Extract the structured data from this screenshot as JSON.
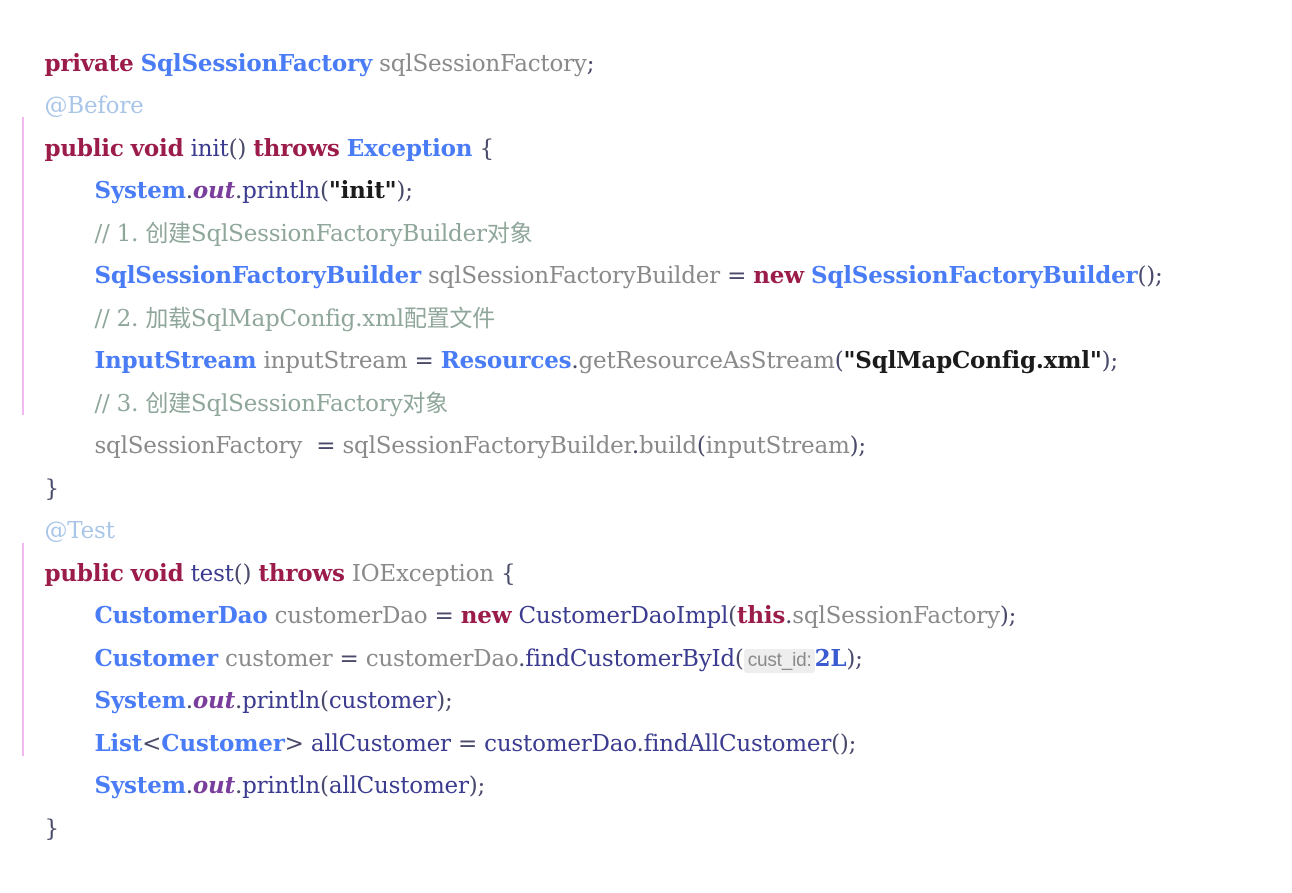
{
  "editor": {
    "language": "java",
    "background": "#ffffff",
    "indent_guide_color": "#f2b8f2",
    "colors": {
      "keyword": "#9b1c4b",
      "type": "#4a7cf6",
      "comment": "#8fa69a",
      "annotation": "#a9c6e8",
      "string": "#1b1b1b",
      "static_field": "#7a3f9d",
      "number": "#3b5bd0",
      "identifier": "#8a8a8a",
      "parameter_hint_bg": "#eeeeee"
    }
  },
  "code": {
    "line01": {
      "kw_private": "private",
      "type_sqlsessionfactory": "SqlSessionFactory",
      "field_name": "sqlSessionFactory",
      "semi": ";"
    },
    "line02": {
      "annotation": "@Before"
    },
    "line03": {
      "kw_public": "public",
      "kw_void": "void",
      "method": "init",
      "parens": "()",
      "kw_throws": "throws",
      "type_exception": "Exception",
      "brace": "{"
    },
    "line04": {
      "system": "System",
      "dot1": ".",
      "out": "out",
      "dot2": ".",
      "println": "println",
      "open": "(",
      "string": "\"init\"",
      "close": ")",
      "semi": ";"
    },
    "line05": {
      "comment": "// 1. 创建SqlSessionFactoryBuilder对象"
    },
    "line06": {
      "type_builder": "SqlSessionFactoryBuilder",
      "var": "sqlSessionFactoryBuilder",
      "eq": "=",
      "kw_new": "new",
      "ctor": "SqlSessionFactoryBuilder",
      "parens": "()",
      "semi": ";"
    },
    "line07": {
      "comment": "// 2. 加载SqlMapConfig.xml配置文件"
    },
    "line08": {
      "type_inputstream": "InputStream",
      "var": "inputStream",
      "eq": "=",
      "type_resources": "Resources",
      "dot": ".",
      "method": "getResourceAsStream",
      "open": "(",
      "string": "\"SqlMapConfig.xml\"",
      "close": ")",
      "semi": ";"
    },
    "line09": {
      "comment": "// 3. 创建SqlSessionFactory对象"
    },
    "line10": {
      "field": "sqlSessionFactory",
      "eq": "=",
      "var": "sqlSessionFactoryBuilder",
      "dot": ".",
      "method": "build",
      "open": "(",
      "arg": "inputStream",
      "close": ")",
      "semi": ";"
    },
    "line11": {
      "brace": "}"
    },
    "line12": {
      "annotation": "@Test"
    },
    "line13": {
      "kw_public": "public",
      "kw_void": "void",
      "method": "test",
      "parens": "()",
      "kw_throws": "throws",
      "type_ioexception": "IOException",
      "brace": "{"
    },
    "line14": {
      "type_customerdao": "CustomerDao",
      "var": "customerDao",
      "eq": "=",
      "kw_new": "new",
      "ctor": "CustomerDaoImpl",
      "open": "(",
      "kw_this": "this",
      "dot": ".",
      "field": "sqlSessionFactory",
      "close": ")",
      "semi": ";"
    },
    "line15": {
      "type_customer": "Customer",
      "var": "customer",
      "eq": "=",
      "obj": "customerDao",
      "dot": ".",
      "method": "findCustomerById",
      "open": "(",
      "param_hint": "cust_id:",
      "number": "2L",
      "close": ")",
      "semi": ";"
    },
    "line16": {
      "system": "System",
      "dot1": ".",
      "out": "out",
      "dot2": ".",
      "println": "println",
      "open": "(",
      "arg": "customer",
      "close": ")",
      "semi": ";"
    },
    "line17": {
      "type_list": "List",
      "lt": "<",
      "type_customer": "Customer",
      "gt": ">",
      "var": "allCustomer",
      "eq": "=",
      "obj": "customerDao",
      "dot": ".",
      "method": "findAllCustomer",
      "parens": "()",
      "semi": ";"
    },
    "line18": {
      "system": "System",
      "dot1": ".",
      "out": "out",
      "dot2": ".",
      "println": "println",
      "open": "(",
      "arg": "allCustomer",
      "close": ")",
      "semi": ";"
    },
    "line19": {
      "brace": "}"
    }
  }
}
